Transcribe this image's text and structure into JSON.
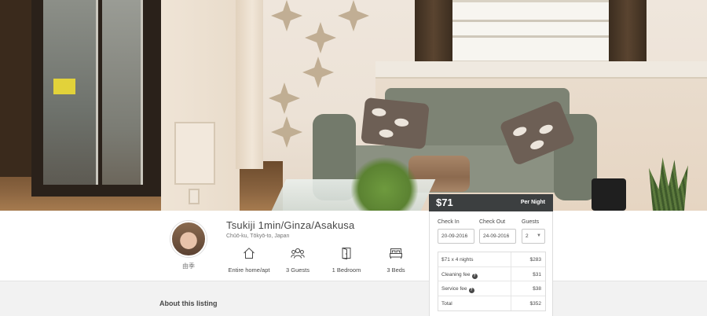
{
  "listing": {
    "title": "Tsukiji 1min/Ginza/Asakusa",
    "location": "Chūō-ku, Tōkyō-to, Japan",
    "host_name": "由季",
    "amenities": [
      {
        "icon": "home-icon",
        "label": "Entire home/apt"
      },
      {
        "icon": "guests-icon",
        "label": "3 Guests"
      },
      {
        "icon": "door-icon",
        "label": "1 Bedroom"
      },
      {
        "icon": "bed-icon",
        "label": "3 Beds"
      }
    ],
    "about_heading": "About this listing"
  },
  "booking": {
    "price": "$71",
    "per_night": "Per Night",
    "check_in_label": "Check In",
    "check_out_label": "Check Out",
    "guests_label": "Guests",
    "check_in_value": "20-09-2016",
    "check_out_value": "24-09-2016",
    "guests_value": "2",
    "rows": [
      {
        "label": "$71 x 4 nights",
        "value": "$283",
        "help": false
      },
      {
        "label": "Cleaning fee",
        "value": "$31",
        "help": true
      },
      {
        "label": "Service fee",
        "value": "$38",
        "help": true
      },
      {
        "label": "Total",
        "value": "$352",
        "help": false
      }
    ]
  },
  "colors": {
    "price_bar": "#3c3f40",
    "text": "#484848",
    "muted": "#767676"
  }
}
